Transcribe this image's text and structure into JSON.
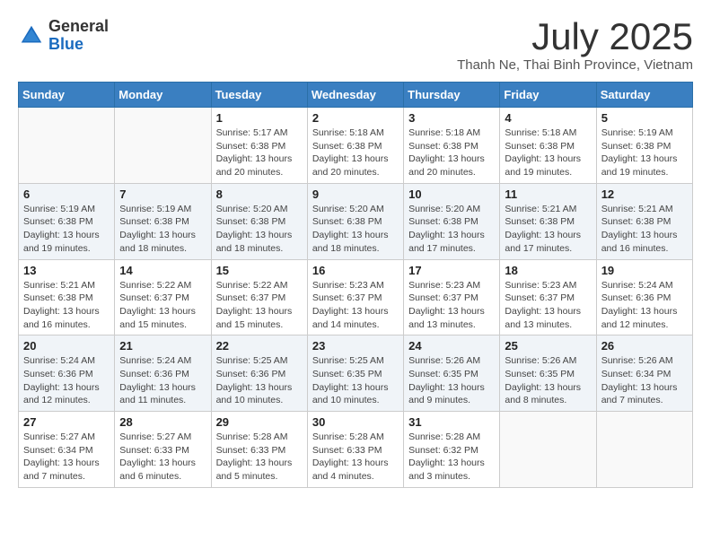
{
  "logo": {
    "general": "General",
    "blue": "Blue"
  },
  "header": {
    "month": "July 2025",
    "location": "Thanh Ne, Thai Binh Province, Vietnam"
  },
  "weekdays": [
    "Sunday",
    "Monday",
    "Tuesday",
    "Wednesday",
    "Thursday",
    "Friday",
    "Saturday"
  ],
  "weeks": [
    [
      {
        "day": "",
        "info": ""
      },
      {
        "day": "",
        "info": ""
      },
      {
        "day": "1",
        "info": "Sunrise: 5:17 AM\nSunset: 6:38 PM\nDaylight: 13 hours and 20 minutes."
      },
      {
        "day": "2",
        "info": "Sunrise: 5:18 AM\nSunset: 6:38 PM\nDaylight: 13 hours and 20 minutes."
      },
      {
        "day": "3",
        "info": "Sunrise: 5:18 AM\nSunset: 6:38 PM\nDaylight: 13 hours and 20 minutes."
      },
      {
        "day": "4",
        "info": "Sunrise: 5:18 AM\nSunset: 6:38 PM\nDaylight: 13 hours and 19 minutes."
      },
      {
        "day": "5",
        "info": "Sunrise: 5:19 AM\nSunset: 6:38 PM\nDaylight: 13 hours and 19 minutes."
      }
    ],
    [
      {
        "day": "6",
        "info": "Sunrise: 5:19 AM\nSunset: 6:38 PM\nDaylight: 13 hours and 19 minutes."
      },
      {
        "day": "7",
        "info": "Sunrise: 5:19 AM\nSunset: 6:38 PM\nDaylight: 13 hours and 18 minutes."
      },
      {
        "day": "8",
        "info": "Sunrise: 5:20 AM\nSunset: 6:38 PM\nDaylight: 13 hours and 18 minutes."
      },
      {
        "day": "9",
        "info": "Sunrise: 5:20 AM\nSunset: 6:38 PM\nDaylight: 13 hours and 18 minutes."
      },
      {
        "day": "10",
        "info": "Sunrise: 5:20 AM\nSunset: 6:38 PM\nDaylight: 13 hours and 17 minutes."
      },
      {
        "day": "11",
        "info": "Sunrise: 5:21 AM\nSunset: 6:38 PM\nDaylight: 13 hours and 17 minutes."
      },
      {
        "day": "12",
        "info": "Sunrise: 5:21 AM\nSunset: 6:38 PM\nDaylight: 13 hours and 16 minutes."
      }
    ],
    [
      {
        "day": "13",
        "info": "Sunrise: 5:21 AM\nSunset: 6:38 PM\nDaylight: 13 hours and 16 minutes."
      },
      {
        "day": "14",
        "info": "Sunrise: 5:22 AM\nSunset: 6:37 PM\nDaylight: 13 hours and 15 minutes."
      },
      {
        "day": "15",
        "info": "Sunrise: 5:22 AM\nSunset: 6:37 PM\nDaylight: 13 hours and 15 minutes."
      },
      {
        "day": "16",
        "info": "Sunrise: 5:23 AM\nSunset: 6:37 PM\nDaylight: 13 hours and 14 minutes."
      },
      {
        "day": "17",
        "info": "Sunrise: 5:23 AM\nSunset: 6:37 PM\nDaylight: 13 hours and 13 minutes."
      },
      {
        "day": "18",
        "info": "Sunrise: 5:23 AM\nSunset: 6:37 PM\nDaylight: 13 hours and 13 minutes."
      },
      {
        "day": "19",
        "info": "Sunrise: 5:24 AM\nSunset: 6:36 PM\nDaylight: 13 hours and 12 minutes."
      }
    ],
    [
      {
        "day": "20",
        "info": "Sunrise: 5:24 AM\nSunset: 6:36 PM\nDaylight: 13 hours and 12 minutes."
      },
      {
        "day": "21",
        "info": "Sunrise: 5:24 AM\nSunset: 6:36 PM\nDaylight: 13 hours and 11 minutes."
      },
      {
        "day": "22",
        "info": "Sunrise: 5:25 AM\nSunset: 6:36 PM\nDaylight: 13 hours and 10 minutes."
      },
      {
        "day": "23",
        "info": "Sunrise: 5:25 AM\nSunset: 6:35 PM\nDaylight: 13 hours and 10 minutes."
      },
      {
        "day": "24",
        "info": "Sunrise: 5:26 AM\nSunset: 6:35 PM\nDaylight: 13 hours and 9 minutes."
      },
      {
        "day": "25",
        "info": "Sunrise: 5:26 AM\nSunset: 6:35 PM\nDaylight: 13 hours and 8 minutes."
      },
      {
        "day": "26",
        "info": "Sunrise: 5:26 AM\nSunset: 6:34 PM\nDaylight: 13 hours and 7 minutes."
      }
    ],
    [
      {
        "day": "27",
        "info": "Sunrise: 5:27 AM\nSunset: 6:34 PM\nDaylight: 13 hours and 7 minutes."
      },
      {
        "day": "28",
        "info": "Sunrise: 5:27 AM\nSunset: 6:33 PM\nDaylight: 13 hours and 6 minutes."
      },
      {
        "day": "29",
        "info": "Sunrise: 5:28 AM\nSunset: 6:33 PM\nDaylight: 13 hours and 5 minutes."
      },
      {
        "day": "30",
        "info": "Sunrise: 5:28 AM\nSunset: 6:33 PM\nDaylight: 13 hours and 4 minutes."
      },
      {
        "day": "31",
        "info": "Sunrise: 5:28 AM\nSunset: 6:32 PM\nDaylight: 13 hours and 3 minutes."
      },
      {
        "day": "",
        "info": ""
      },
      {
        "day": "",
        "info": ""
      }
    ]
  ]
}
